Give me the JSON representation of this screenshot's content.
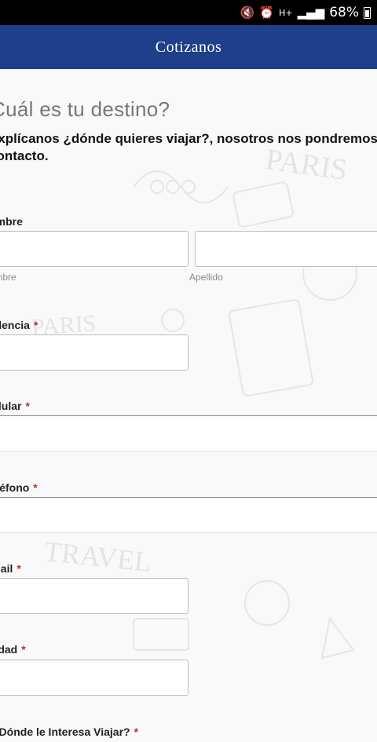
{
  "status_bar": {
    "battery": "68%",
    "network": "H+"
  },
  "app_bar": {
    "title": "Cotizanos"
  },
  "form": {
    "heading": "Cuál es tu destino?",
    "subheading_line1": "Explícanos ¿dónde quieres viajar?, nosotros nos pondremos en",
    "subheading_line2": "contacto.",
    "name_label": "Nombre",
    "first_name_sublabel": "Nombre",
    "last_name_sublabel": "Apellido",
    "residence_label": "Residencia",
    "mobile_label": "Celular",
    "phone_label": "Teléfono",
    "email_label": "Email",
    "age_label": "Edad",
    "destination_label": "¿Dónde le Interesa Viajar?",
    "required_mark": "*"
  },
  "doodles": {
    "paris": "PARIS",
    "travel": "TRAVEL"
  }
}
